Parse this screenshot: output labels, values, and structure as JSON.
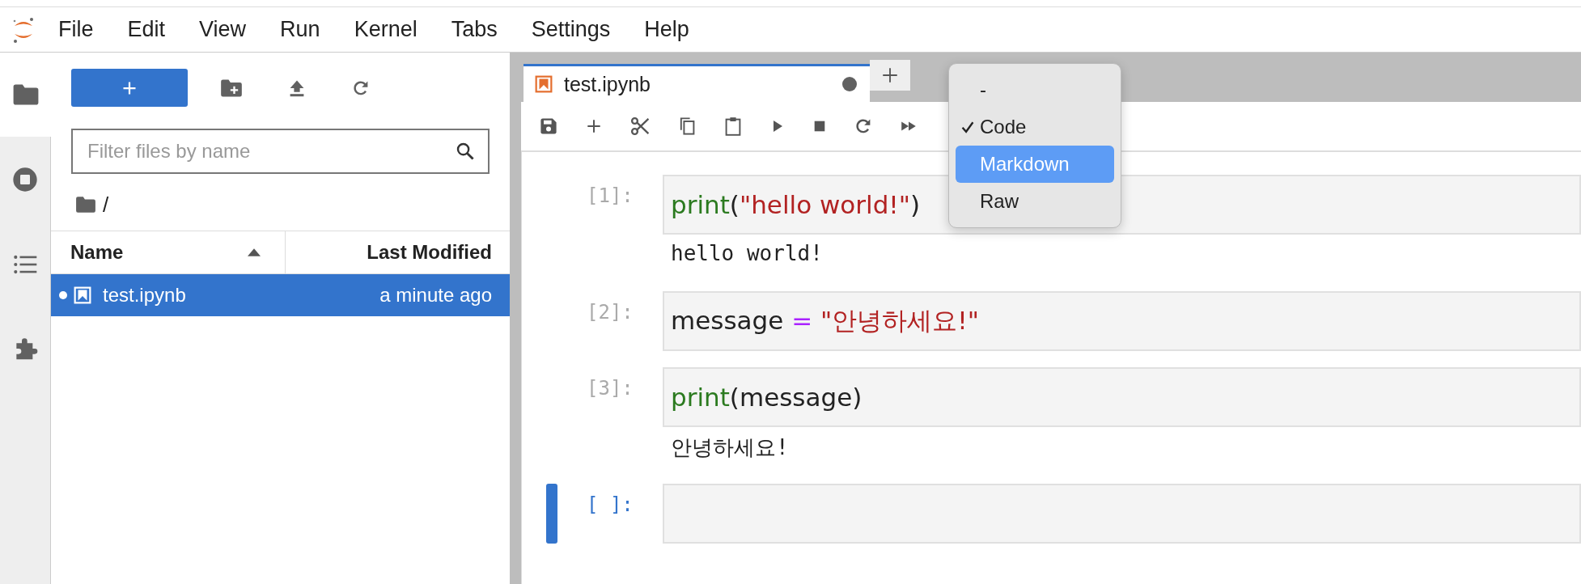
{
  "menu_bar": {
    "items": [
      "File",
      "Edit",
      "View",
      "Run",
      "Kernel",
      "Tabs",
      "Settings",
      "Help"
    ]
  },
  "file_browser": {
    "filter": {
      "placeholder": "Filter files by name"
    },
    "path": "/",
    "columns": [
      {
        "label": "Name",
        "sorted": true
      },
      {
        "label": "Last Modified",
        "sorted": false
      }
    ],
    "rows": [
      {
        "name": "test.ipynb",
        "modified": "a minute ago",
        "selected": true,
        "running": true
      }
    ]
  },
  "tabs": [
    {
      "label": "test.ipynb",
      "selected": true,
      "dirty": true
    }
  ],
  "cells": [
    {
      "prompt": "[1]:",
      "active": false,
      "code": [
        {
          "text": "print",
          "kind": "builtin"
        },
        {
          "text": "(",
          "kind": "plain"
        },
        {
          "text": "\"hello world!\"",
          "kind": "string"
        },
        {
          "text": ")",
          "kind": "plain"
        }
      ],
      "output": "hello world!"
    },
    {
      "prompt": "[2]:",
      "active": false,
      "code": [
        {
          "text": "message ",
          "kind": "plain"
        },
        {
          "text": "=",
          "kind": "operator"
        },
        {
          "text": " \"안녕하세요!\"",
          "kind": "string"
        }
      ]
    },
    {
      "prompt": "[3]:",
      "active": false,
      "code": [
        {
          "text": "print",
          "kind": "builtin"
        },
        {
          "text": "(message)",
          "kind": "plain"
        }
      ],
      "output": "안녕하세요!"
    },
    {
      "prompt": "[ ]:",
      "active": true
    }
  ],
  "cell_type_menu": {
    "items": [
      {
        "label": "-",
        "checked": false,
        "selected": false
      },
      {
        "label": "Code",
        "checked": true,
        "selected": false
      },
      {
        "label": "Markdown",
        "checked": false,
        "selected": true
      },
      {
        "label": "Raw",
        "checked": false,
        "selected": false
      }
    ]
  }
}
